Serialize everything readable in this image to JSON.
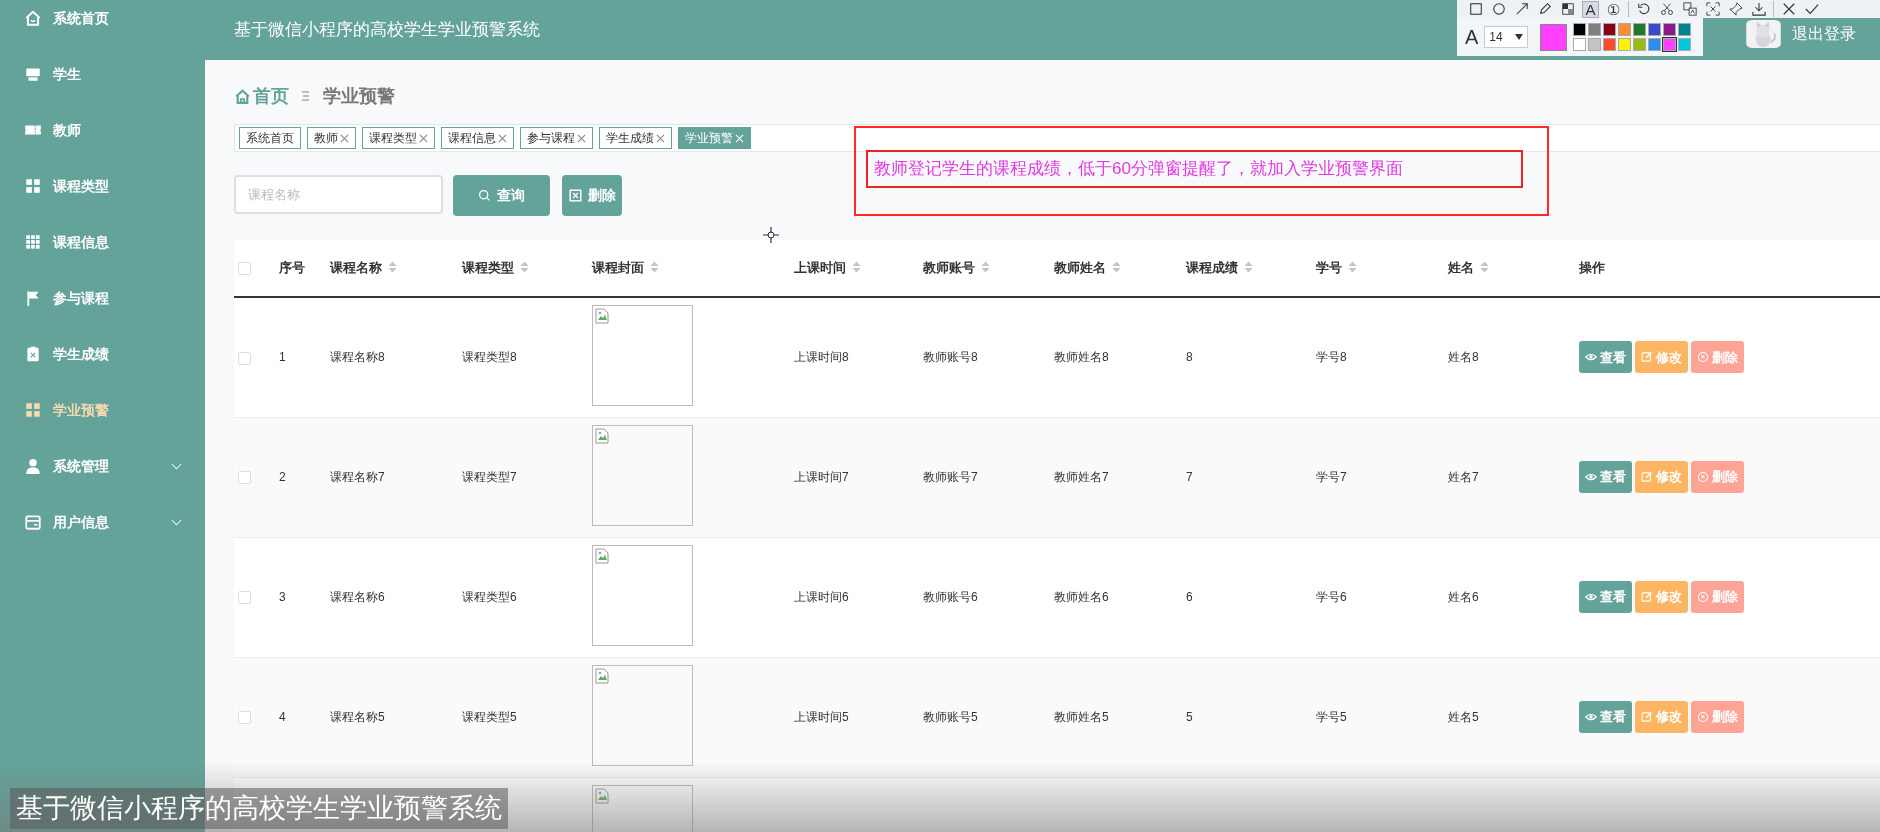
{
  "app_title": "基于微信小程序的高校学生学业预警系统",
  "sidebar": {
    "items": [
      {
        "label": "系统首页",
        "selected": false
      },
      {
        "label": "学生",
        "selected": false
      },
      {
        "label": "教师",
        "selected": false
      },
      {
        "label": "课程类型",
        "selected": false
      },
      {
        "label": "课程信息",
        "selected": false
      },
      {
        "label": "参与课程",
        "selected": false
      },
      {
        "label": "学生成绩",
        "selected": false
      },
      {
        "label": "学业预警",
        "selected": true
      },
      {
        "label": "系统管理",
        "selected": false,
        "expanded": false
      },
      {
        "label": "用户信息",
        "selected": false,
        "expanded": false
      }
    ]
  },
  "header": {
    "logout": "退出登录"
  },
  "capture_toolbar": {
    "tools": [
      {
        "kind": "rect",
        "selected": false
      },
      {
        "kind": "ellipse",
        "selected": false
      },
      {
        "kind": "arrow",
        "selected": false
      },
      {
        "kind": "pencil",
        "selected": false
      },
      {
        "kind": "mosaic",
        "selected": false
      },
      {
        "kind": "text",
        "label": "A",
        "selected": true
      },
      {
        "kind": "number",
        "label": "①",
        "selected": false
      },
      {
        "kind": "divider"
      },
      {
        "kind": "undo",
        "selected": false
      },
      {
        "kind": "cut",
        "selected": false
      },
      {
        "kind": "translate",
        "selected": false
      },
      {
        "kind": "ocr",
        "selected": false
      },
      {
        "kind": "pin",
        "selected": false
      },
      {
        "kind": "download",
        "selected": false
      },
      {
        "kind": "divider"
      },
      {
        "kind": "cancel",
        "selected": false
      },
      {
        "kind": "confirm",
        "selected": false
      }
    ],
    "font_label": "A",
    "font_size": "14",
    "palette": [
      {
        "color": "#000000",
        "selected": false
      },
      {
        "color": "#7f7f7f",
        "selected": false
      },
      {
        "color": "#880015",
        "selected": false
      },
      {
        "color": "#ff8c32",
        "selected": false
      },
      {
        "color": "#22782a",
        "selected": false
      },
      {
        "color": "#3f48cc",
        "selected": false
      },
      {
        "color": "#8b1a8b",
        "selected": false
      },
      {
        "color": "#00838f",
        "selected": false
      },
      {
        "color": "#ffffff",
        "selected": false
      },
      {
        "color": "#c3c3c3",
        "selected": false
      },
      {
        "color": "#ff4b2b",
        "selected": false
      },
      {
        "color": "#fff200",
        "selected": false
      },
      {
        "color": "#9bbb12",
        "selected": false
      },
      {
        "color": "#2e8bef",
        "selected": false
      },
      {
        "color": "#ff40ff",
        "selected": true
      },
      {
        "color": "#00c8e0",
        "selected": false
      }
    ]
  },
  "breadcrumb": {
    "home": "首页",
    "current": "学业预警"
  },
  "tabs": [
    {
      "label": "系统首页",
      "closable": false,
      "selected": false
    },
    {
      "label": "教师",
      "closable": true,
      "selected": false
    },
    {
      "label": "课程类型",
      "closable": true,
      "selected": false
    },
    {
      "label": "课程信息",
      "closable": true,
      "selected": false
    },
    {
      "label": "参与课程",
      "closable": true,
      "selected": false
    },
    {
      "label": "学生成绩",
      "closable": true,
      "selected": false
    },
    {
      "label": "学业预警",
      "closable": true,
      "selected": true
    }
  ],
  "search": {
    "placeholder": "课程名称",
    "query_button": "查询",
    "delete_button": "删除"
  },
  "annotation": {
    "text": "教师登记学生的课程成绩，低于60分弹窗提醒了，就加入学业预警界面"
  },
  "table": {
    "select_all": {
      "checked": false
    },
    "columns": [
      {
        "label": "序号",
        "sortable": false
      },
      {
        "label": "课程名称",
        "sortable": true
      },
      {
        "label": "课程类型",
        "sortable": true
      },
      {
        "label": "课程封面",
        "sortable": true
      },
      {
        "label": "上课时间",
        "sortable": true
      },
      {
        "label": "教师账号",
        "sortable": true
      },
      {
        "label": "教师姓名",
        "sortable": true
      },
      {
        "label": "课程成绩",
        "sortable": true
      },
      {
        "label": "学号",
        "sortable": true
      },
      {
        "label": "姓名",
        "sortable": true
      },
      {
        "label": "操作",
        "sortable": false
      }
    ],
    "rows": [
      {
        "checked": false,
        "cells": [
          "1",
          "课程名称8",
          "课程类型8",
          "",
          "上课时间8",
          "教师账号8",
          "教师姓名8",
          "8",
          "学号8",
          "姓名8"
        ],
        "actions": [
          {
            "kind": "view",
            "label": "查看"
          },
          {
            "kind": "edit",
            "label": "修改"
          },
          {
            "kind": "delete",
            "label": "删除"
          }
        ]
      },
      {
        "checked": false,
        "cells": [
          "2",
          "课程名称7",
          "课程类型7",
          "",
          "上课时间7",
          "教师账号7",
          "教师姓名7",
          "7",
          "学号7",
          "姓名7"
        ],
        "actions": [
          {
            "kind": "view",
            "label": "查看"
          },
          {
            "kind": "edit",
            "label": "修改"
          },
          {
            "kind": "delete",
            "label": "删除"
          }
        ]
      },
      {
        "checked": false,
        "cells": [
          "3",
          "课程名称6",
          "课程类型6",
          "",
          "上课时间6",
          "教师账号6",
          "教师姓名6",
          "6",
          "学号6",
          "姓名6"
        ],
        "actions": [
          {
            "kind": "view",
            "label": "查看"
          },
          {
            "kind": "edit",
            "label": "修改"
          },
          {
            "kind": "delete",
            "label": "删除"
          }
        ]
      },
      {
        "checked": false,
        "cells": [
          "4",
          "课程名称5",
          "课程类型5",
          "",
          "上课时间5",
          "教师账号5",
          "教师姓名5",
          "5",
          "学号5",
          "姓名5"
        ],
        "actions": [
          {
            "kind": "view",
            "label": "查看"
          },
          {
            "kind": "edit",
            "label": "修改"
          },
          {
            "kind": "delete",
            "label": "删除"
          }
        ]
      }
    ]
  },
  "caption": "基于微信小程序的高校学生学业预警系统"
}
